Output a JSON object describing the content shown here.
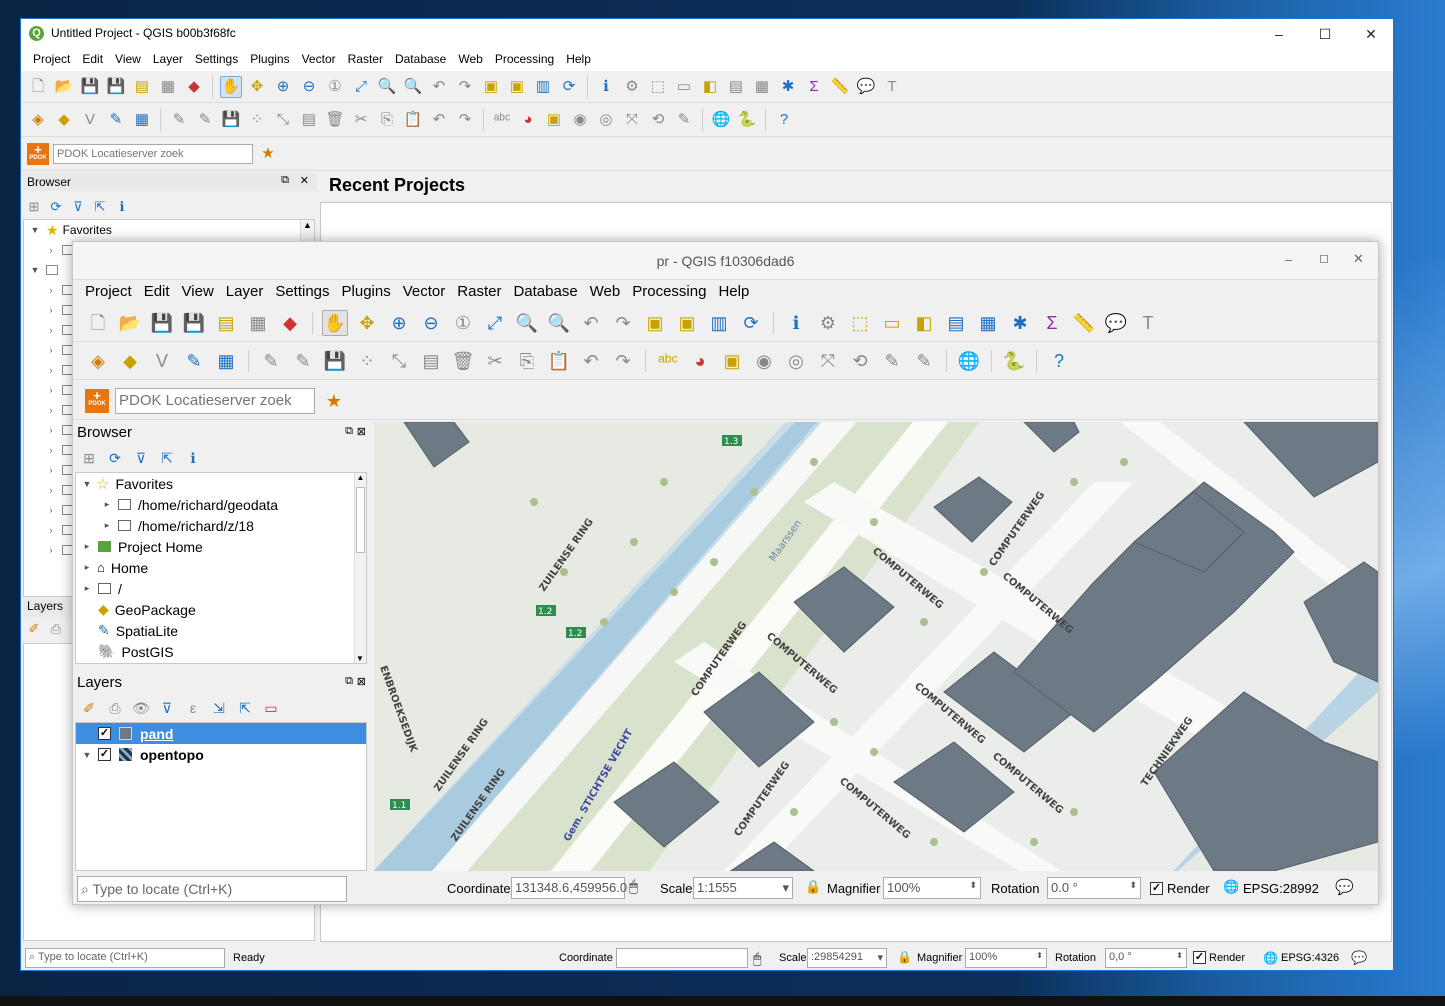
{
  "outer": {
    "title": "Untitled Project - QGIS b00b3f68fc",
    "menu": [
      "Project",
      "Edit",
      "View",
      "Layer",
      "Settings",
      "Plugins",
      "Vector",
      "Raster",
      "Database",
      "Web",
      "Processing",
      "Help"
    ],
    "pdok_placeholder": "PDOK Locatieserver zoek",
    "browser_title": "Browser",
    "browser_favorites": "Favorites",
    "layers_title": "Layers",
    "recent_projects": "Recent Projects",
    "status": {
      "locate_placeholder": "Type to locate (Ctrl+K)",
      "ready": "Ready",
      "coordinate_label": "Coordinate",
      "coordinate_value": "",
      "scale_label": "Scale",
      "scale_value": ":29854291",
      "magnifier_label": "Magnifier",
      "magnifier_value": "100%",
      "rotation_label": "Rotation",
      "rotation_value": "0,0 °",
      "render_label": "Render",
      "crs": "EPSG:4326"
    }
  },
  "inner": {
    "title": "pr - QGIS f10306dad6",
    "menu": [
      "Project",
      "Edit",
      "View",
      "Layer",
      "Settings",
      "Plugins",
      "Vector",
      "Raster",
      "Database",
      "Web",
      "Processing",
      "Help"
    ],
    "pdok_placeholder": "PDOK Locatieserver zoek",
    "browser_title": "Browser",
    "browser_items": [
      {
        "label": "Favorites",
        "icon": "star-icon",
        "level": 0,
        "expanded": true
      },
      {
        "label": "/home/richard/geodata",
        "icon": "folder-icon",
        "level": 1,
        "expanded": false
      },
      {
        "label": "/home/richard/z/18",
        "icon": "folder-icon",
        "level": 1,
        "expanded": false
      },
      {
        "label": "Project Home",
        "icon": "project-home-icon",
        "level": 0,
        "expanded": false
      },
      {
        "label": "Home",
        "icon": "home-icon",
        "level": 0,
        "expanded": false
      },
      {
        "label": "/",
        "icon": "folder-icon",
        "level": 0,
        "expanded": false
      },
      {
        "label": "GeoPackage",
        "icon": "geopackage-icon",
        "level": 0,
        "expanded": null
      },
      {
        "label": "SpatiaLite",
        "icon": "spatialite-icon",
        "level": 0,
        "expanded": null
      },
      {
        "label": "PostGIS",
        "icon": "postgis-icon",
        "level": 0,
        "expanded": null
      }
    ],
    "layers_title": "Layers",
    "layers": [
      {
        "name": "pand",
        "checked": true,
        "selected": true
      },
      {
        "name": "opentopo",
        "checked": true,
        "selected": false
      }
    ],
    "map_labels": [
      "ZUILENSE RING",
      "ZUILENSE RING",
      "ZUILENSE RING",
      "COMPUTERWEG",
      "COMPUTERWEG",
      "COMPUTERWEG",
      "COMPUTERWEG",
      "COMPUTERWEG",
      "COMPUTERWEG",
      "COMPUTERWEG",
      "COMPUTERWEG",
      "COMPUTERWEG",
      "TECHNIEKWEG",
      "Gem. STICHTSE VECHT",
      "Maarssen",
      "ENBROEKSEDIJK",
      "1.2",
      "1.2",
      "1.3",
      "1.1"
    ],
    "status": {
      "locate_placeholder": "Type to locate (Ctrl+K)",
      "coordinate_label": "Coordinate",
      "coordinate_value": "131348.6,459956.0",
      "scale_label": "Scale",
      "scale_value": "1:1555",
      "magnifier_label": "Magnifier",
      "magnifier_value": "100%",
      "rotation_label": "Rotation",
      "rotation_value": "0.0 °",
      "render_label": "Render",
      "crs": "EPSG:28992"
    }
  }
}
